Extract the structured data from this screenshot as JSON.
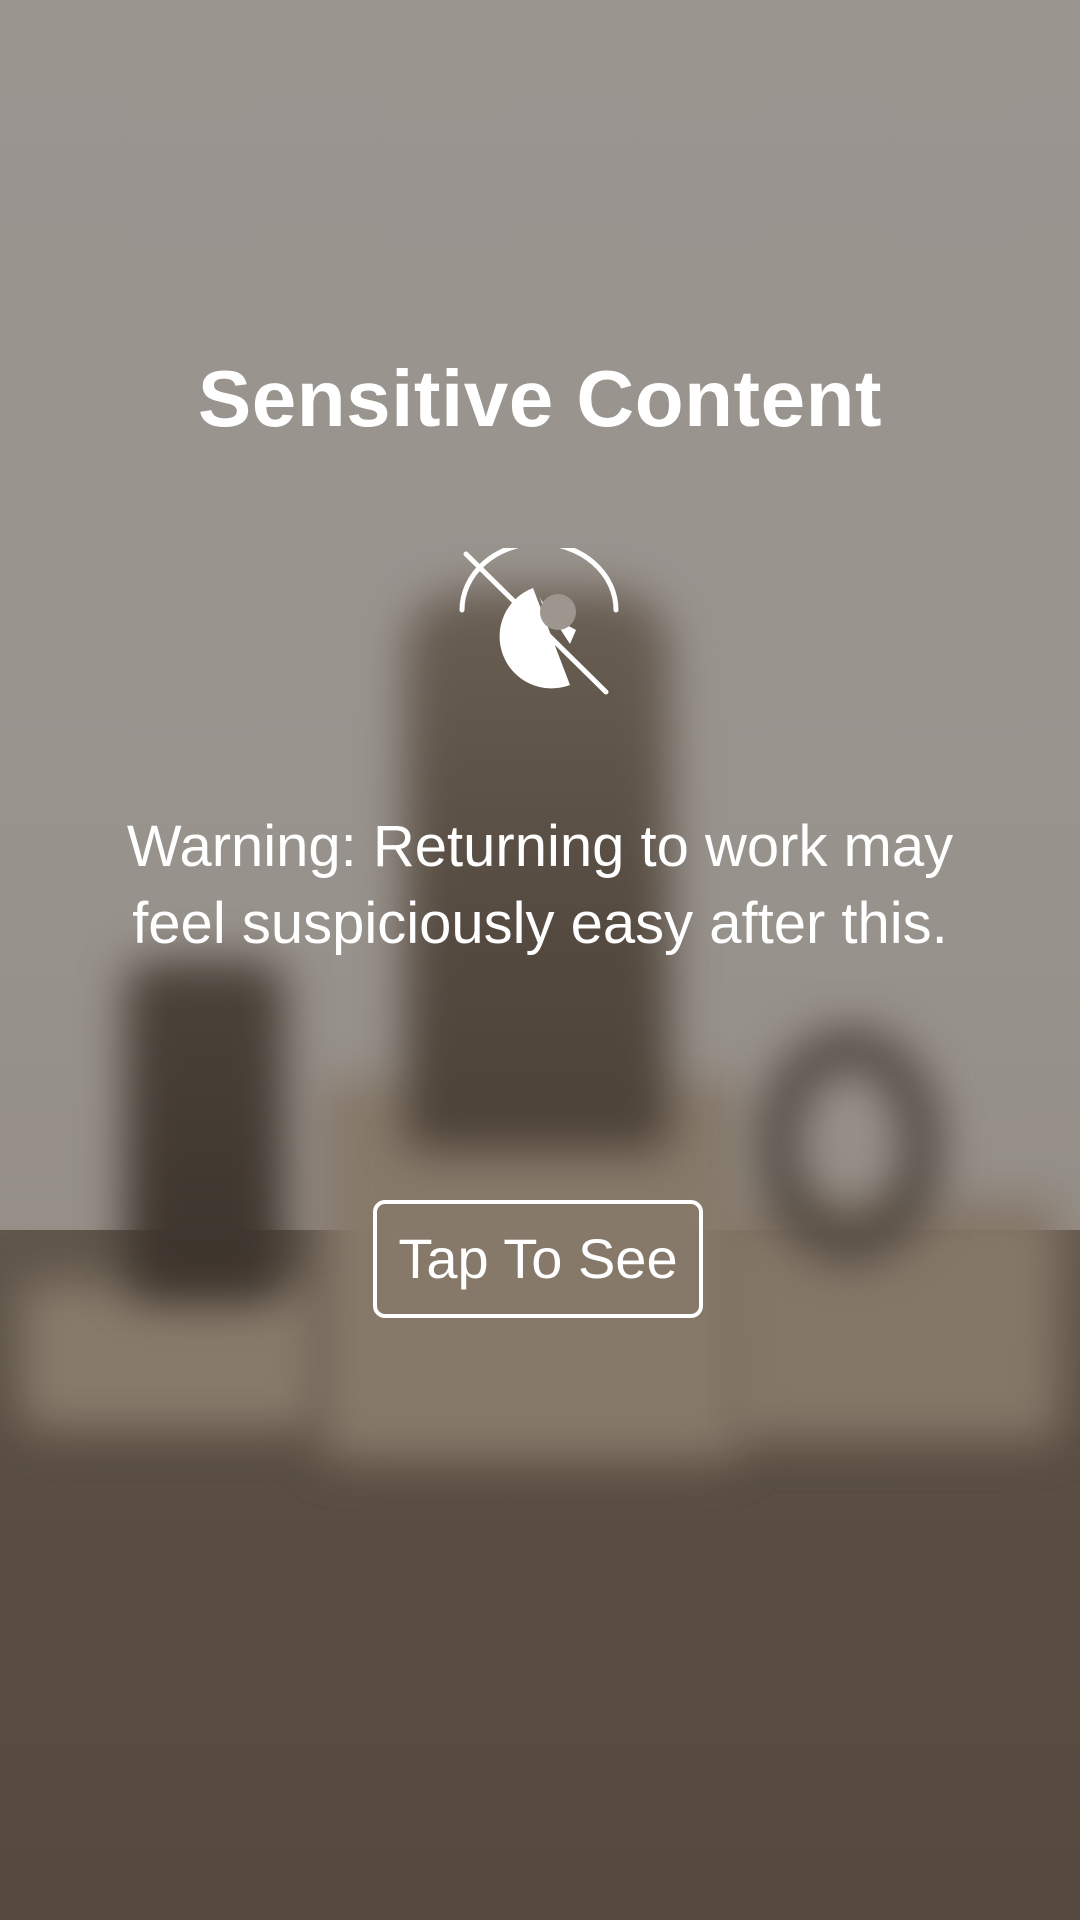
{
  "sensitive_overlay": {
    "title": "Sensitive Content",
    "icon": "eye-hidden-icon",
    "message": "Warning: Returning to work may feel suspiciously easy after this.",
    "button_label": "Tap To See"
  },
  "colors": {
    "text": "#ffffff",
    "button_border": "#ffffff",
    "backdrop_wall": "#a29c96",
    "backdrop_table": "#5c5044"
  }
}
